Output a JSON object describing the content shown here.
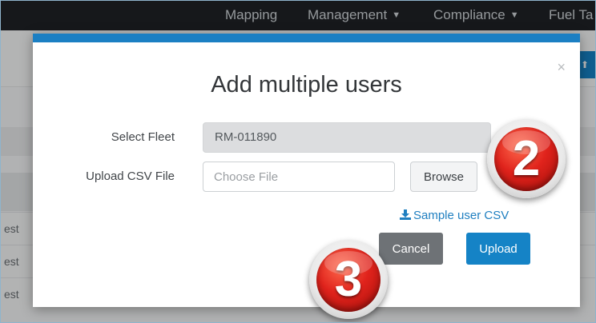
{
  "nav": {
    "items": [
      {
        "label": "Mapping",
        "caret": false
      },
      {
        "label": "Management",
        "caret": true
      },
      {
        "label": "Compliance",
        "caret": true
      },
      {
        "label": "Fuel Ta",
        "caret": false
      }
    ]
  },
  "background": {
    "row_text": "est",
    "right_button_icon": "upload-icon"
  },
  "modal": {
    "title": "Add multiple users",
    "close_label": "×",
    "fleet_label": "Select Fleet",
    "fleet_value": "RM-011890",
    "csv_label": "Upload CSV File",
    "file_placeholder": "Choose File",
    "browse_label": "Browse",
    "sample_link_label": "Sample user CSV",
    "cancel_label": "Cancel",
    "upload_label": "Upload"
  },
  "badges": {
    "step_two": "2",
    "step_three": "3"
  },
  "colors": {
    "primary": "#1583c6",
    "modal_top_border": "#1b7fc3",
    "cancel": "#6e7276",
    "navbar": "#1f2226",
    "badge_red": "#e0231c"
  }
}
